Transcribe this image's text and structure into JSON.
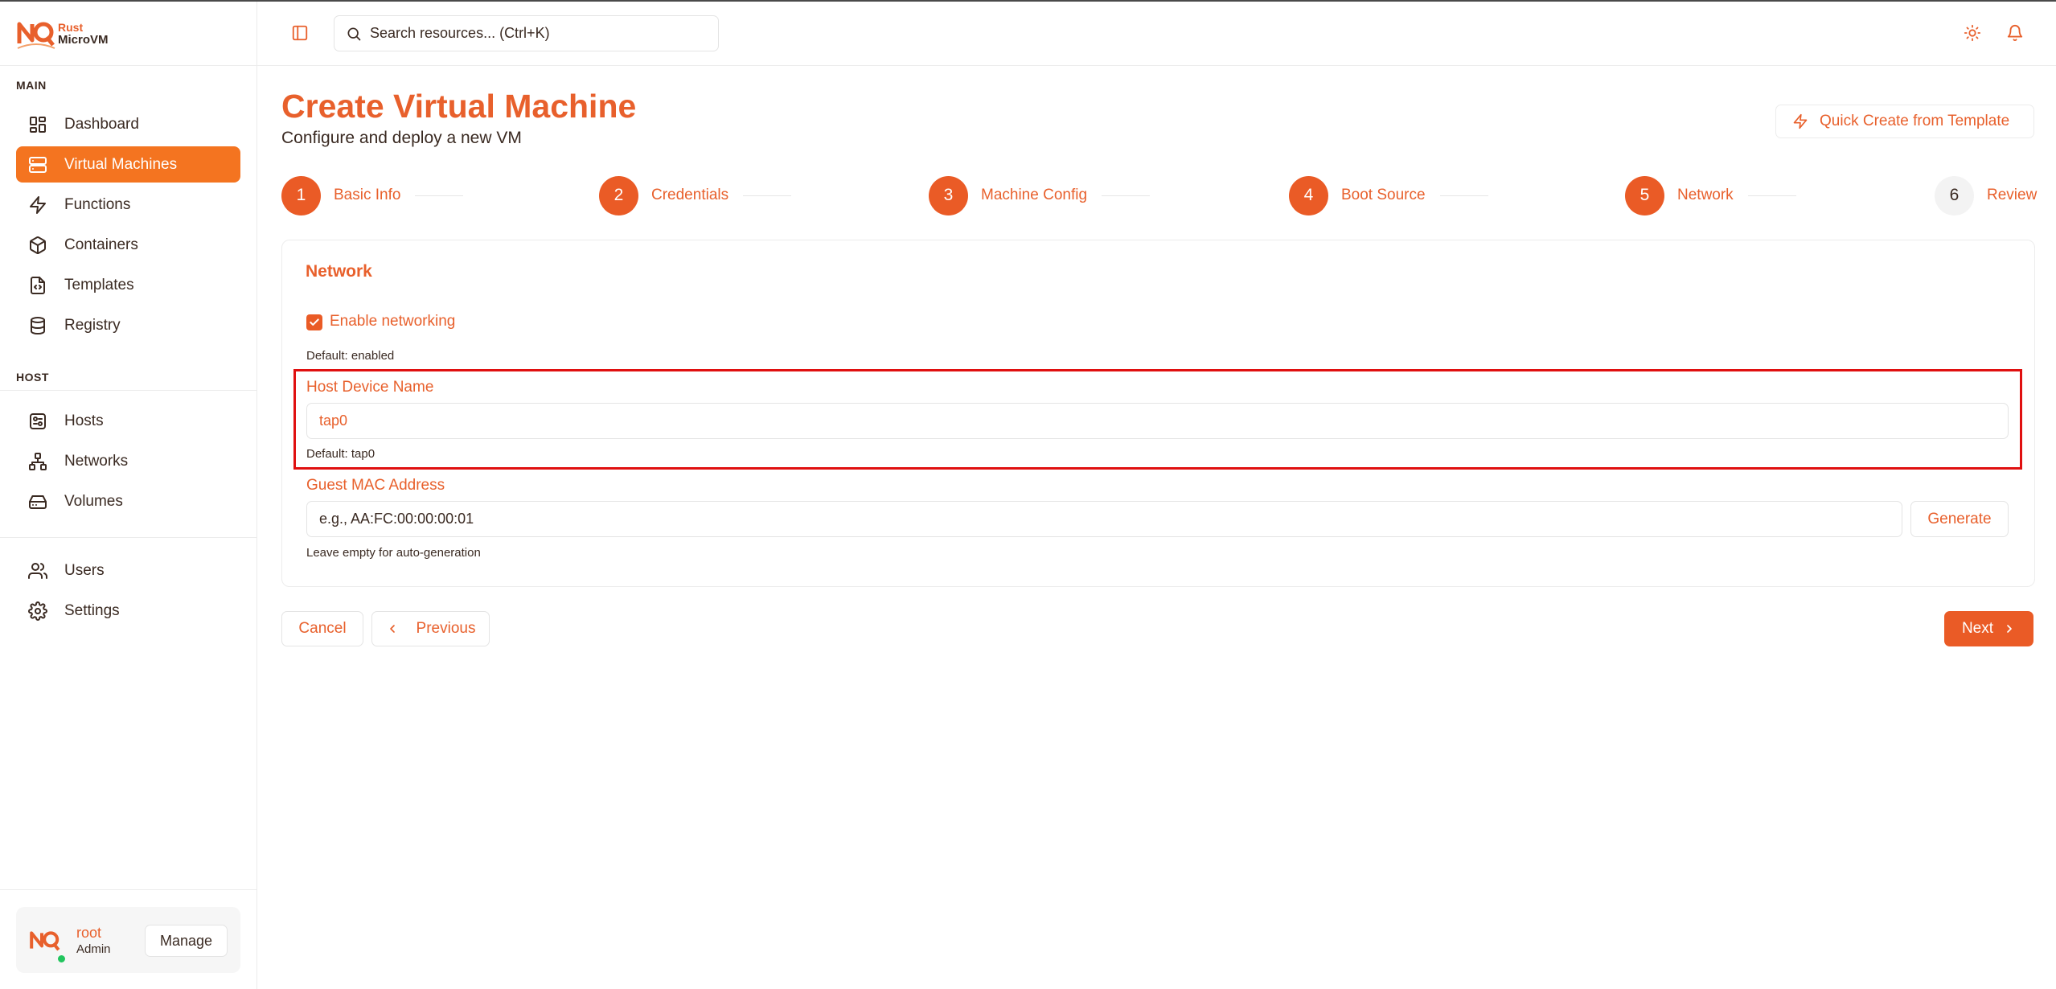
{
  "app": {
    "logo_line1": "Rust",
    "logo_line2": "MicroVM"
  },
  "sidebar": {
    "main_label": "MAIN",
    "main_items": [
      {
        "label": "Dashboard",
        "icon": "dashboard-icon"
      },
      {
        "label": "Virtual Machines",
        "icon": "server-icon",
        "active": true
      },
      {
        "label": "Functions",
        "icon": "lightning-icon"
      },
      {
        "label": "Containers",
        "icon": "box-icon"
      },
      {
        "label": "Templates",
        "icon": "file-code-icon"
      },
      {
        "label": "Registry",
        "icon": "database-icon"
      }
    ],
    "host_label": "HOST",
    "host_items": [
      {
        "label": "Hosts",
        "icon": "host-icon"
      },
      {
        "label": "Networks",
        "icon": "network-icon"
      },
      {
        "label": "Volumes",
        "icon": "drive-icon"
      }
    ],
    "other_items": [
      {
        "label": "Users",
        "icon": "users-icon"
      },
      {
        "label": "Settings",
        "icon": "gear-icon"
      }
    ],
    "user": {
      "name": "root",
      "role": "Admin",
      "manage_label": "Manage",
      "status": "online"
    }
  },
  "topbar": {
    "search_placeholder": "Search resources... (Ctrl+K)"
  },
  "page": {
    "title": "Create Virtual Machine",
    "subtitle": "Configure and deploy a new VM",
    "quick_create_label": "Quick Create from Template"
  },
  "steps": [
    {
      "number": "1",
      "label": "Basic Info",
      "state": "complete"
    },
    {
      "number": "2",
      "label": "Credentials",
      "state": "complete"
    },
    {
      "number": "3",
      "label": "Machine Config",
      "state": "complete"
    },
    {
      "number": "4",
      "label": "Boot Source",
      "state": "complete"
    },
    {
      "number": "5",
      "label": "Network",
      "state": "current"
    },
    {
      "number": "6",
      "label": "Review",
      "state": "upcoming"
    }
  ],
  "form": {
    "section_title": "Network",
    "enable_networking_label": "Enable networking",
    "enable_networking_checked": true,
    "enable_networking_hint": "Default: enabled",
    "host_device_label": "Host Device Name",
    "host_device_value": "tap0",
    "host_device_hint": "Default: tap0",
    "guest_mac_label": "Guest MAC Address",
    "guest_mac_placeholder": "e.g., AA:FC:00:00:00:01",
    "guest_mac_hint": "Leave empty for auto-generation",
    "generate_label": "Generate"
  },
  "actions": {
    "cancel_label": "Cancel",
    "previous_label": "Previous",
    "next_label": "Next"
  },
  "colors": {
    "accent": "#ea5b26",
    "active_nav": "#f47420",
    "highlight": "#e01010"
  }
}
